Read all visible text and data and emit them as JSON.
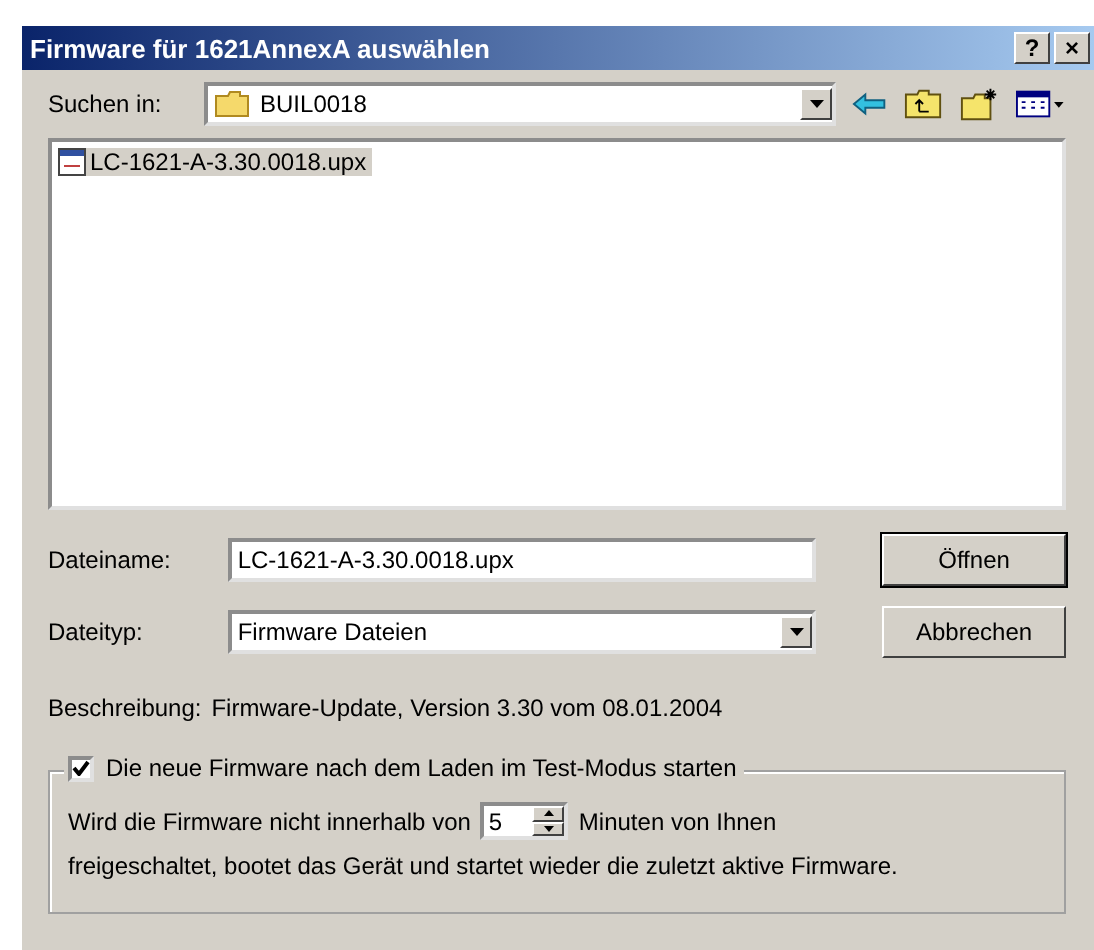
{
  "window": {
    "title": "Firmware für 1621AnnexA auswählen",
    "help": "?",
    "close": "×"
  },
  "look_in": {
    "label": "Suchen in:",
    "value": "BUIL0018"
  },
  "files": [
    {
      "name": "LC-1621-A-3.30.0018.upx",
      "selected": true
    }
  ],
  "filename": {
    "label": "Dateiname:",
    "value": "LC-1621-A-3.30.0018.upx"
  },
  "filetype": {
    "label": "Dateityp:",
    "value": "Firmware Dateien"
  },
  "buttons": [
    {
      "label": "Öffnen",
      "default": true
    },
    {
      "label": "Abbrechen",
      "default": false
    }
  ],
  "description": {
    "label": "Beschreibung:",
    "value": "Firmware-Update, Version 3.30 vom 08.01.2004"
  },
  "test_mode": {
    "label": "Die neue Firmware nach dem Laden im Test-Modus starten",
    "checked": true,
    "text_before": "Wird die Firmware nicht innerhalb von",
    "minutes": "5",
    "text_after": "Minuten von Ihnen",
    "text_line2": "freigeschaltet, bootet das Gerät und startet wieder die zuletzt aktive Firmware."
  }
}
